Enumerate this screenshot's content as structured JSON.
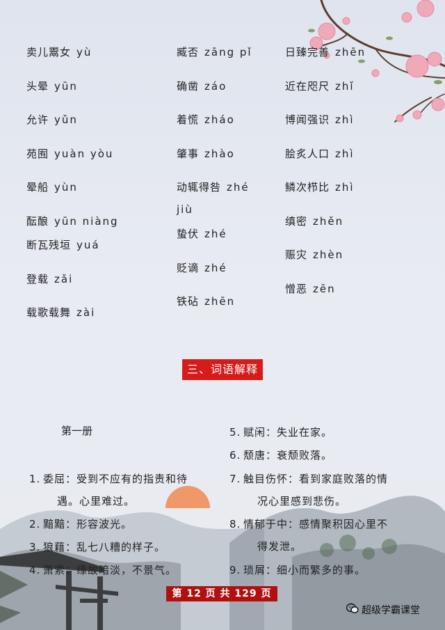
{
  "col1": [
    {
      "word": "卖儿鬻女",
      "pinyin": "yù"
    },
    {
      "word": "头晕",
      "pinyin": "yūn"
    },
    {
      "word": "允许",
      "pinyin": "yǔn"
    },
    {
      "word": "苑囿",
      "pinyin": "yuàn yòu"
    },
    {
      "word": "晕船",
      "pinyin": "yùn"
    },
    {
      "word": "酝酿",
      "pinyin": "yūn niàng"
    },
    {
      "word": "断瓦残垣",
      "pinyin": "yuá"
    },
    {
      "word": "登载",
      "pinyin": "zǎi"
    },
    {
      "word": "载歌载舞",
      "pinyin": "zài"
    }
  ],
  "col2": [
    {
      "word": "臧否",
      "pinyin": "zāng pǐ"
    },
    {
      "word": "确凿",
      "pinyin": "záo"
    },
    {
      "word": "着慌",
      "pinyin": "zháo"
    },
    {
      "word": "肇事",
      "pinyin": "zhào"
    },
    {
      "word": "动辄得咎",
      "pinyin": "zhé"
    },
    {
      "word": "",
      "pinyin": "jiù"
    },
    {
      "word": "蛰伏",
      "pinyin": "zhé"
    },
    {
      "word": "贬谪",
      "pinyin": "zhé"
    },
    {
      "word": "铁砧",
      "pinyin": "zhēn"
    }
  ],
  "col3": [
    {
      "word": "日臻完善",
      "pinyin": "zhēn"
    },
    {
      "word": "近在咫尺",
      "pinyin": "zhǐ"
    },
    {
      "word": "博闻强识",
      "pinyin": "zhì"
    },
    {
      "word": "脍炙人口",
      "pinyin": "zhì"
    },
    {
      "word": "鳞次栉比",
      "pinyin": "zhì"
    },
    {
      "word": "缜密",
      "pinyin": "zhěn"
    },
    {
      "word": "赈灾",
      "pinyin": "zhèn"
    },
    {
      "word": "憎恶",
      "pinyin": "zēn"
    }
  ],
  "section_title": "三、词语解释",
  "subhead": "第一册",
  "defs_left": [
    {
      "num": "1.",
      "line1": "委屈：受到不应有的指责和待",
      "line2": "遇。心里难过。"
    },
    {
      "num": "2.",
      "line1": "黯黯：形容波光。",
      "line2": ""
    },
    {
      "num": "3.",
      "line1": "狼藉：乱七八糟的样子。",
      "line2": ""
    },
    {
      "num": "4.",
      "line1": "萧索：缘故暗淡，不景气。",
      "line2": ""
    }
  ],
  "defs_right": [
    {
      "num": "5.",
      "line1": "赋闲：失业在家。",
      "line2": ""
    },
    {
      "num": "6.",
      "line1": "颓唐：衰颓败落。",
      "line2": ""
    },
    {
      "num": "7.",
      "line1": "触目伤怀：看到家庭败落的情",
      "line2": "况心里感到悲伤。"
    },
    {
      "num": "8.",
      "line1": "情郁于中：感情聚积因心里不",
      "line2": "得发泄。"
    },
    {
      "num": "9.",
      "line1": "琐屑：细小而繁多的事。",
      "line2": ""
    }
  ],
  "page_indicator": "第 12 页 共 129 页",
  "watermark": "超级学霸课堂",
  "icons": {
    "watermark_icon": "wechat-icon"
  },
  "colors": {
    "title_bg": "#d61b1b",
    "pagebar_bg": "#b01010",
    "blossom": "#f0a9b8"
  }
}
